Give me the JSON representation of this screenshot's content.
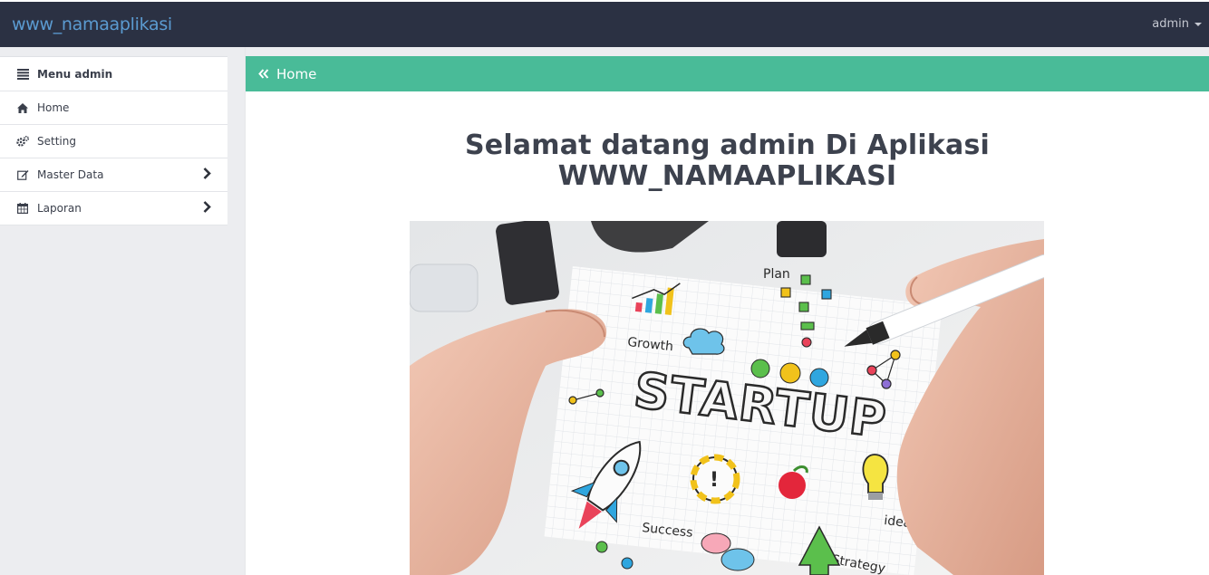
{
  "app": {
    "brand": "www_namaaplikasi",
    "user_menu": "admin"
  },
  "sidebar": {
    "header": "Menu admin",
    "items": [
      {
        "label": "Home",
        "icon": "home-icon",
        "has_submenu": false
      },
      {
        "label": "Setting",
        "icon": "gears-icon",
        "has_submenu": false
      },
      {
        "label": "Master Data",
        "icon": "edit-icon",
        "has_submenu": true
      },
      {
        "label": "Laporan",
        "icon": "calendar-icon",
        "has_submenu": true
      }
    ]
  },
  "breadcrumb": {
    "label": "Home"
  },
  "main": {
    "welcome_line1": "Selamat datang admin Di Aplikasi",
    "welcome_line2": "WWW_NAMAAPLIKASI",
    "hero_words": {
      "startup": "STARTUP",
      "plan": "Plan",
      "growth": "Growth",
      "success": "Success",
      "idea": "idea",
      "strategy": "Strategy"
    }
  },
  "colors": {
    "navbar": "#2b3143",
    "brand": "#5b9bd1",
    "accent": "#49bb98",
    "sidebar_bg": "#ecedf0"
  }
}
